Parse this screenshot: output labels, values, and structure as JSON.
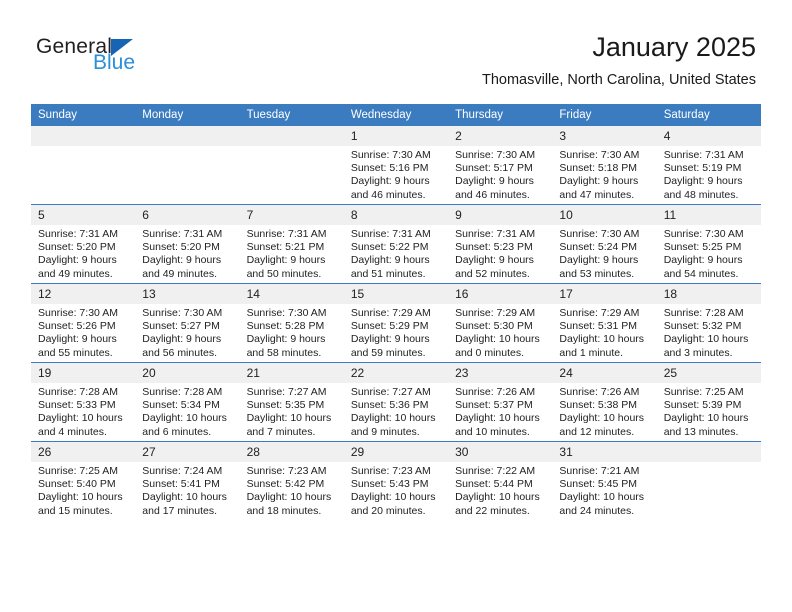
{
  "brand": {
    "name_part1": "General",
    "name_part2": "Blue",
    "triangle_icon": "triangle-icon",
    "accent_dark_blue": "#1665b5",
    "accent_light_blue": "#2b8fd8"
  },
  "header": {
    "title": "January 2025",
    "location": "Thomasville, North Carolina, United States"
  },
  "theme": {
    "header_row_bg": "#3b7cc0",
    "daynum_bg": "#f0f0f0",
    "text": "#1a1a1a"
  },
  "weekdays": [
    "Sunday",
    "Monday",
    "Tuesday",
    "Wednesday",
    "Thursday",
    "Friday",
    "Saturday"
  ],
  "labels": {
    "sunrise_prefix": "Sunrise:",
    "sunset_prefix": "Sunset:",
    "daylight_prefix": "Daylight:"
  },
  "weeks": [
    [
      {
        "day": "",
        "sunrise": "",
        "sunset": "",
        "daylight_line1": "",
        "daylight_line2": ""
      },
      {
        "day": "",
        "sunrise": "",
        "sunset": "",
        "daylight_line1": "",
        "daylight_line2": ""
      },
      {
        "day": "",
        "sunrise": "",
        "sunset": "",
        "daylight_line1": "",
        "daylight_line2": ""
      },
      {
        "day": "1",
        "sunrise": "Sunrise: 7:30 AM",
        "sunset": "Sunset: 5:16 PM",
        "daylight_line1": "Daylight: 9 hours",
        "daylight_line2": "and 46 minutes."
      },
      {
        "day": "2",
        "sunrise": "Sunrise: 7:30 AM",
        "sunset": "Sunset: 5:17 PM",
        "daylight_line1": "Daylight: 9 hours",
        "daylight_line2": "and 46 minutes."
      },
      {
        "day": "3",
        "sunrise": "Sunrise: 7:30 AM",
        "sunset": "Sunset: 5:18 PM",
        "daylight_line1": "Daylight: 9 hours",
        "daylight_line2": "and 47 minutes."
      },
      {
        "day": "4",
        "sunrise": "Sunrise: 7:31 AM",
        "sunset": "Sunset: 5:19 PM",
        "daylight_line1": "Daylight: 9 hours",
        "daylight_line2": "and 48 minutes."
      }
    ],
    [
      {
        "day": "5",
        "sunrise": "Sunrise: 7:31 AM",
        "sunset": "Sunset: 5:20 PM",
        "daylight_line1": "Daylight: 9 hours",
        "daylight_line2": "and 49 minutes."
      },
      {
        "day": "6",
        "sunrise": "Sunrise: 7:31 AM",
        "sunset": "Sunset: 5:20 PM",
        "daylight_line1": "Daylight: 9 hours",
        "daylight_line2": "and 49 minutes."
      },
      {
        "day": "7",
        "sunrise": "Sunrise: 7:31 AM",
        "sunset": "Sunset: 5:21 PM",
        "daylight_line1": "Daylight: 9 hours",
        "daylight_line2": "and 50 minutes."
      },
      {
        "day": "8",
        "sunrise": "Sunrise: 7:31 AM",
        "sunset": "Sunset: 5:22 PM",
        "daylight_line1": "Daylight: 9 hours",
        "daylight_line2": "and 51 minutes."
      },
      {
        "day": "9",
        "sunrise": "Sunrise: 7:31 AM",
        "sunset": "Sunset: 5:23 PM",
        "daylight_line1": "Daylight: 9 hours",
        "daylight_line2": "and 52 minutes."
      },
      {
        "day": "10",
        "sunrise": "Sunrise: 7:30 AM",
        "sunset": "Sunset: 5:24 PM",
        "daylight_line1": "Daylight: 9 hours",
        "daylight_line2": "and 53 minutes."
      },
      {
        "day": "11",
        "sunrise": "Sunrise: 7:30 AM",
        "sunset": "Sunset: 5:25 PM",
        "daylight_line1": "Daylight: 9 hours",
        "daylight_line2": "and 54 minutes."
      }
    ],
    [
      {
        "day": "12",
        "sunrise": "Sunrise: 7:30 AM",
        "sunset": "Sunset: 5:26 PM",
        "daylight_line1": "Daylight: 9 hours",
        "daylight_line2": "and 55 minutes."
      },
      {
        "day": "13",
        "sunrise": "Sunrise: 7:30 AM",
        "sunset": "Sunset: 5:27 PM",
        "daylight_line1": "Daylight: 9 hours",
        "daylight_line2": "and 56 minutes."
      },
      {
        "day": "14",
        "sunrise": "Sunrise: 7:30 AM",
        "sunset": "Sunset: 5:28 PM",
        "daylight_line1": "Daylight: 9 hours",
        "daylight_line2": "and 58 minutes."
      },
      {
        "day": "15",
        "sunrise": "Sunrise: 7:29 AM",
        "sunset": "Sunset: 5:29 PM",
        "daylight_line1": "Daylight: 9 hours",
        "daylight_line2": "and 59 minutes."
      },
      {
        "day": "16",
        "sunrise": "Sunrise: 7:29 AM",
        "sunset": "Sunset: 5:30 PM",
        "daylight_line1": "Daylight: 10 hours",
        "daylight_line2": "and 0 minutes."
      },
      {
        "day": "17",
        "sunrise": "Sunrise: 7:29 AM",
        "sunset": "Sunset: 5:31 PM",
        "daylight_line1": "Daylight: 10 hours",
        "daylight_line2": "and 1 minute."
      },
      {
        "day": "18",
        "sunrise": "Sunrise: 7:28 AM",
        "sunset": "Sunset: 5:32 PM",
        "daylight_line1": "Daylight: 10 hours",
        "daylight_line2": "and 3 minutes."
      }
    ],
    [
      {
        "day": "19",
        "sunrise": "Sunrise: 7:28 AM",
        "sunset": "Sunset: 5:33 PM",
        "daylight_line1": "Daylight: 10 hours",
        "daylight_line2": "and 4 minutes."
      },
      {
        "day": "20",
        "sunrise": "Sunrise: 7:28 AM",
        "sunset": "Sunset: 5:34 PM",
        "daylight_line1": "Daylight: 10 hours",
        "daylight_line2": "and 6 minutes."
      },
      {
        "day": "21",
        "sunrise": "Sunrise: 7:27 AM",
        "sunset": "Sunset: 5:35 PM",
        "daylight_line1": "Daylight: 10 hours",
        "daylight_line2": "and 7 minutes."
      },
      {
        "day": "22",
        "sunrise": "Sunrise: 7:27 AM",
        "sunset": "Sunset: 5:36 PM",
        "daylight_line1": "Daylight: 10 hours",
        "daylight_line2": "and 9 minutes."
      },
      {
        "day": "23",
        "sunrise": "Sunrise: 7:26 AM",
        "sunset": "Sunset: 5:37 PM",
        "daylight_line1": "Daylight: 10 hours",
        "daylight_line2": "and 10 minutes."
      },
      {
        "day": "24",
        "sunrise": "Sunrise: 7:26 AM",
        "sunset": "Sunset: 5:38 PM",
        "daylight_line1": "Daylight: 10 hours",
        "daylight_line2": "and 12 minutes."
      },
      {
        "day": "25",
        "sunrise": "Sunrise: 7:25 AM",
        "sunset": "Sunset: 5:39 PM",
        "daylight_line1": "Daylight: 10 hours",
        "daylight_line2": "and 13 minutes."
      }
    ],
    [
      {
        "day": "26",
        "sunrise": "Sunrise: 7:25 AM",
        "sunset": "Sunset: 5:40 PM",
        "daylight_line1": "Daylight: 10 hours",
        "daylight_line2": "and 15 minutes."
      },
      {
        "day": "27",
        "sunrise": "Sunrise: 7:24 AM",
        "sunset": "Sunset: 5:41 PM",
        "daylight_line1": "Daylight: 10 hours",
        "daylight_line2": "and 17 minutes."
      },
      {
        "day": "28",
        "sunrise": "Sunrise: 7:23 AM",
        "sunset": "Sunset: 5:42 PM",
        "daylight_line1": "Daylight: 10 hours",
        "daylight_line2": "and 18 minutes."
      },
      {
        "day": "29",
        "sunrise": "Sunrise: 7:23 AM",
        "sunset": "Sunset: 5:43 PM",
        "daylight_line1": "Daylight: 10 hours",
        "daylight_line2": "and 20 minutes."
      },
      {
        "day": "30",
        "sunrise": "Sunrise: 7:22 AM",
        "sunset": "Sunset: 5:44 PM",
        "daylight_line1": "Daylight: 10 hours",
        "daylight_line2": "and 22 minutes."
      },
      {
        "day": "31",
        "sunrise": "Sunrise: 7:21 AM",
        "sunset": "Sunset: 5:45 PM",
        "daylight_line1": "Daylight: 10 hours",
        "daylight_line2": "and 24 minutes."
      },
      {
        "day": "",
        "sunrise": "",
        "sunset": "",
        "daylight_line1": "",
        "daylight_line2": ""
      }
    ]
  ]
}
